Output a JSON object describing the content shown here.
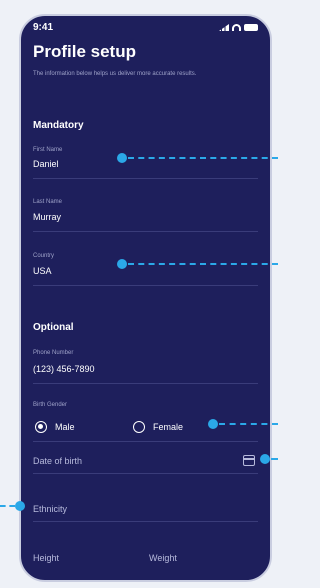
{
  "status": {
    "time": "9:41"
  },
  "header": {
    "title": "Profile setup",
    "subtitle": "The information below helps us deliver more accurate results."
  },
  "mandatory": {
    "heading": "Mandatory",
    "first_name": {
      "label": "First Name",
      "value": "Daniel"
    },
    "last_name": {
      "label": "Last Name",
      "value": "Murray"
    },
    "country": {
      "label": "Country",
      "value": "USA"
    }
  },
  "optional": {
    "heading": "Optional",
    "phone": {
      "label": "Phone Number",
      "value": "(123) 456-7890"
    },
    "birth_gender": {
      "label": "Birth Gender",
      "options": [
        "Male",
        "Female"
      ],
      "selected": "Male"
    },
    "date_of_birth": {
      "placeholder": "Date of birth"
    },
    "ethnicity": {
      "placeholder": "Ethnicity"
    },
    "height": {
      "placeholder": "Height"
    },
    "weight": {
      "placeholder": "Weight"
    }
  },
  "colors": {
    "background": "#1e1f5c",
    "accent": "#2ba8e8"
  }
}
